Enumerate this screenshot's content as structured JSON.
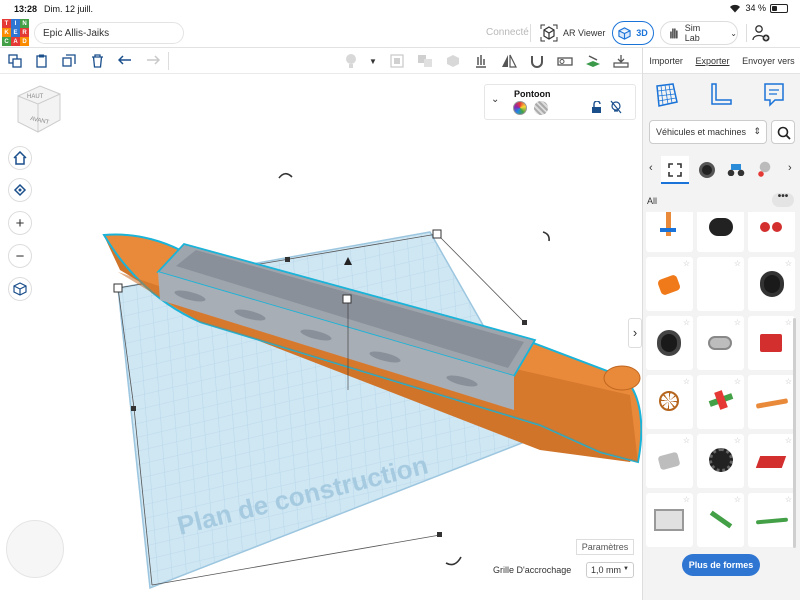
{
  "status": {
    "time": "13:28",
    "date": "Dim. 12 juill.",
    "battery": "34 %",
    "battery_level": 0.34
  },
  "logo_letters": [
    "T",
    "I",
    "N",
    "K",
    "E",
    "R",
    "C",
    "A",
    "D"
  ],
  "header": {
    "design_title": "Epic Allis-Jaiks",
    "connect_label": "Connecté",
    "ar_viewer_label": "AR Viewer",
    "view3d_label": "3D",
    "simlab_label": "Sim Lab"
  },
  "shape_panel": {
    "name": "Pontoon"
  },
  "workplane_label": "Plan de construction",
  "view_cube": {
    "top": "HAUT",
    "front": "AVANT"
  },
  "right_panel": {
    "tabs": {
      "import": "Importer",
      "export": "Exporter",
      "send": "Envoyer vers"
    },
    "category": "Véhicules et machines",
    "all_label": "All",
    "more_label": "•••",
    "more_shapes_button": "Plus de formes"
  },
  "bottom": {
    "params_button": "Paramètres",
    "snap_label": "Grille D'accrochage",
    "snap_value": "1,0 mm"
  },
  "colors": {
    "accent": "#1a73d8",
    "hull": "#e8893a",
    "workplane": "#bcdcf0",
    "button": "#2f76d3"
  }
}
